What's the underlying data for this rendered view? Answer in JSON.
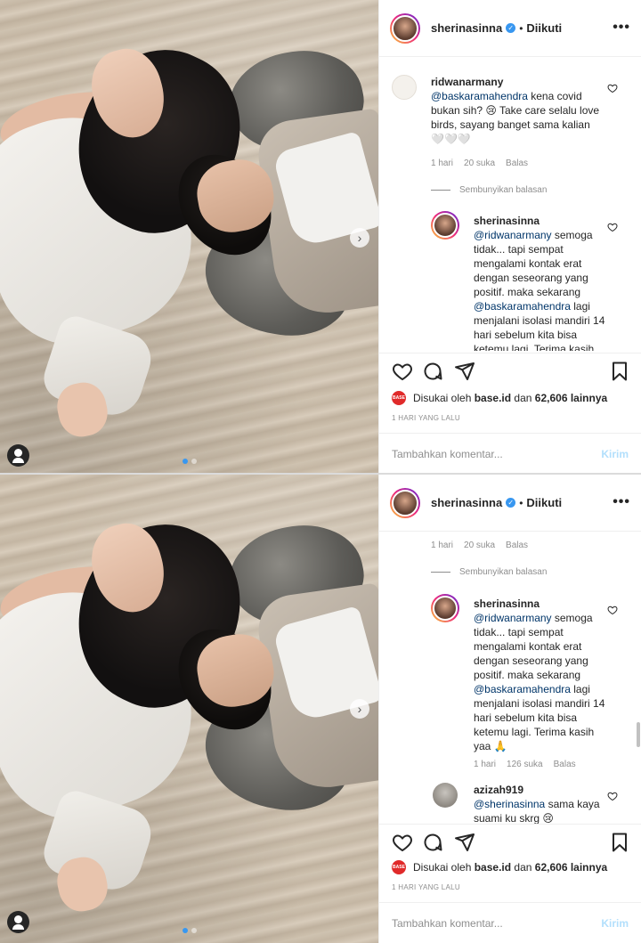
{
  "post": {
    "username": "sherinasinna",
    "verified_mark": "✓",
    "separator": "•",
    "follow_status": "Diikuti",
    "more_label": "•••",
    "comment_ridwan": {
      "user": "ridwanarmany",
      "mention": "@baskaramahendra",
      "text": " kena covid bukan sih? 😢 Take care selalu love birds, sayang banget sama kalian 🤍🤍🤍",
      "time": "1 hari",
      "likes": "20 suka",
      "reply": "Balas"
    },
    "hide_replies": "Sembunyikan balasan",
    "reply_sherina": {
      "user": "sherinasinna",
      "mention1": "@ridwanarmany",
      "text1": " semoga tidak... tapi sempat mengalami kontak erat dengan seseorang yang positif. maka sekarang ",
      "mention2": "@baskaramahendra",
      "text2": " lagi menjalani isolasi mandiri 14 hari sebelum kita bisa ketemu lagi. Terima kasih yaa 🙏",
      "time": "1 hari",
      "likes": "126 suka",
      "reply": "Balas"
    },
    "reply_azizah": {
      "user": "azizah919",
      "mention": "@sherinasinna",
      "text": " sama kaya suami ku skrg 😢"
    },
    "likes_prefix": "Disukai oleh",
    "likes_user": "base.id",
    "likes_mid": "dan",
    "likes_count": "62,606 lainnya",
    "liker_avatar_text": "BASE",
    "time_ago": "1 HARI YANG LALU",
    "comment_placeholder": "Tambahkan komentar...",
    "post_button": "Kirim",
    "carousel_next": "›"
  },
  "colors": {
    "link": "#003569",
    "accent_blue": "#3897f0",
    "post_button_disabled": "#b2dffc",
    "meta_gray": "#8e8e8e"
  },
  "icons": [
    "heart-icon",
    "comment-icon",
    "share-icon",
    "bookmark-icon",
    "more-icon",
    "verified-badge-icon",
    "user-tag-icon",
    "chevron-right-icon"
  ]
}
